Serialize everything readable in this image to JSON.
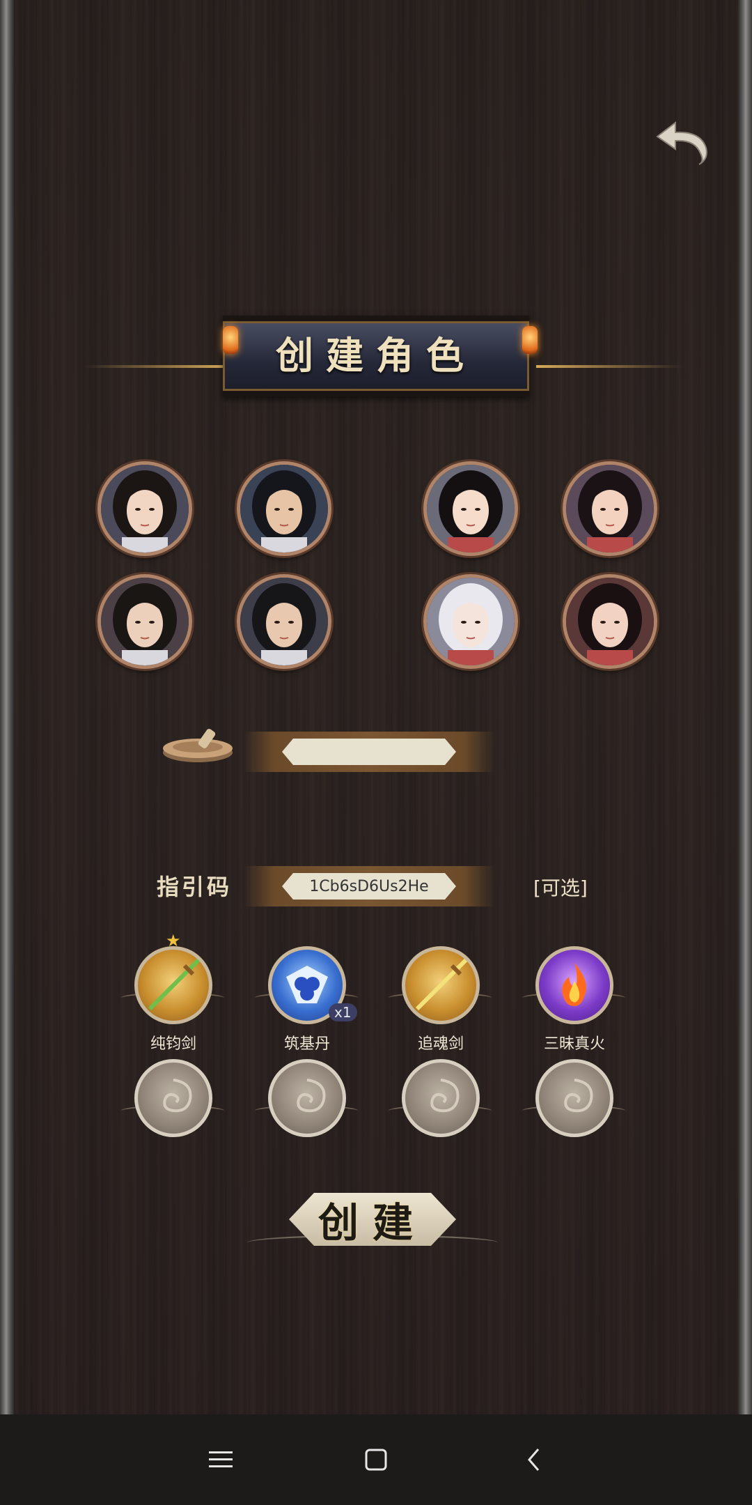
{
  "header": {
    "title": "创建角色",
    "back_icon": "undo-arrow-icon"
  },
  "portraits": [
    {
      "name": "male-portrait-1"
    },
    {
      "name": "male-portrait-2"
    },
    {
      "name": "female-portrait-1"
    },
    {
      "name": "female-portrait-2"
    },
    {
      "name": "male-portrait-3"
    },
    {
      "name": "male-portrait-4"
    },
    {
      "name": "female-portrait-3"
    },
    {
      "name": "female-portrait-4"
    }
  ],
  "name_field": {
    "icon": "seal-stone-icon",
    "value": ""
  },
  "referral": {
    "label": "指引码",
    "value": "1Cb6sD6Us2He",
    "optional_label": "[可选]"
  },
  "rewards": [
    {
      "label": "纯钧剑",
      "style": "gold",
      "icon": "sword-icon"
    },
    {
      "label": "筑基丹",
      "style": "blue",
      "icon": "pill-icon",
      "quantity": "x1"
    },
    {
      "label": "追魂剑",
      "style": "gold",
      "icon": "sword-icon"
    },
    {
      "label": "三昧真火",
      "style": "purple",
      "icon": "flame-icon"
    }
  ],
  "empty_slots": 4,
  "create_button": {
    "label": "创建"
  },
  "nav_bar": {
    "menu_icon": "menu-icon",
    "home_icon": "home-square-icon",
    "back_icon": "back-chevron-icon"
  }
}
